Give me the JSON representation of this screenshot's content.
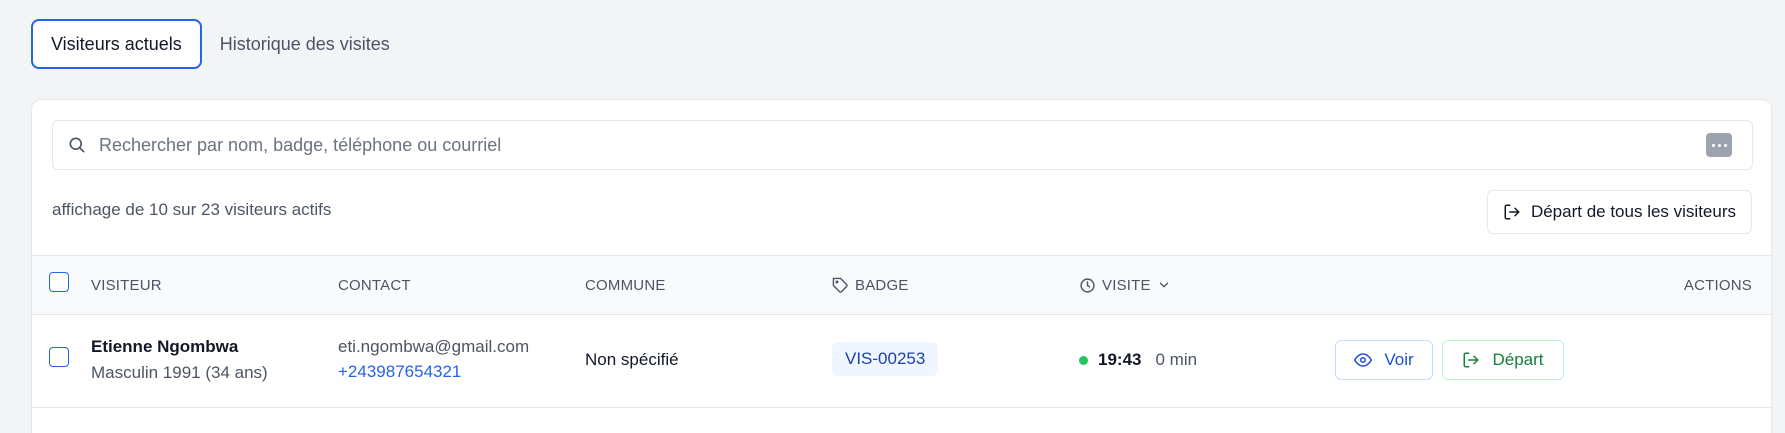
{
  "tabs": {
    "current_label": "Visiteurs actuels",
    "history_label": "Historique des visites"
  },
  "search": {
    "placeholder": "Rechercher par nom, badge, téléphone ou courriel",
    "value": ""
  },
  "summary": {
    "count_text": "affichage de 10 sur 23 visiteurs actifs"
  },
  "toolbar": {
    "checkout_all_label": "Départ de tous les visiteurs"
  },
  "table": {
    "headers": {
      "visitor": "VISITEUR",
      "contact": "CONTACT",
      "commune": "COMMUNE",
      "badge": "BADGE",
      "visit": "VISITE",
      "actions": "ACTIONS"
    },
    "rows": [
      {
        "name": "Etienne Ngombwa",
        "details": "Masculin 1991 (34 ans)",
        "email": "eti.ngombwa@gmail.com",
        "phone": "+243987654321",
        "commune": "Non spécifié",
        "badge": "VIS-00253",
        "time": "19:43",
        "duration": "0 min",
        "view_label": "Voir",
        "checkout_label": "Départ"
      }
    ]
  },
  "colors": {
    "accent": "#2563eb",
    "success": "#22c55e",
    "checkout_green": "#15803d"
  }
}
